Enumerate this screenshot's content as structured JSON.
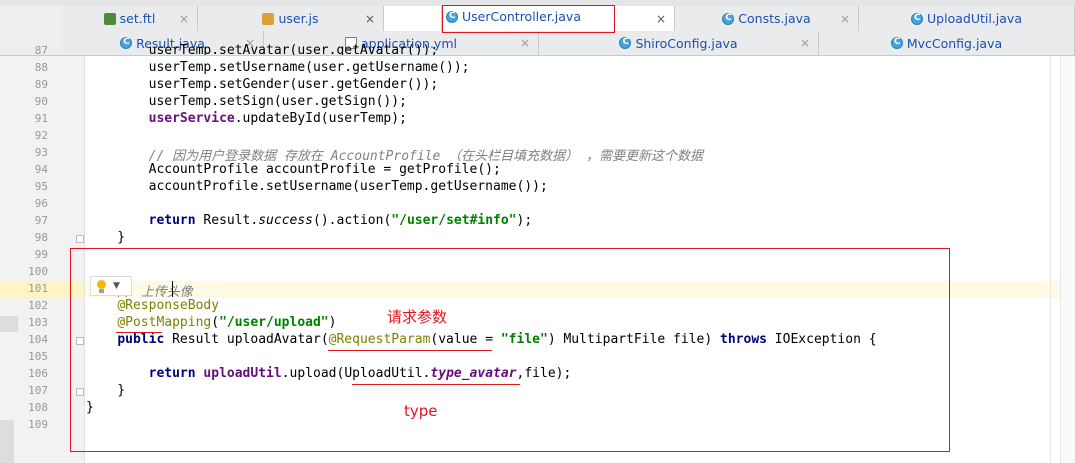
{
  "tabs_row1": [
    {
      "label": "set.ftl",
      "icon": "ftl-file-icon",
      "close": "×"
    },
    {
      "label": "user.js",
      "icon": "js-file-icon",
      "close": "×"
    },
    {
      "label": "",
      "icon": "",
      "close": ""
    },
    {
      "label": "UserController.java",
      "icon": "java-class-icon",
      "close": "×"
    },
    {
      "label": "Consts.java",
      "icon": "java-class-icon",
      "close": "×"
    },
    {
      "label": "UploadUtil.java",
      "icon": "java-class-icon",
      "close": ""
    }
  ],
  "tabs_row2": [
    {
      "label": "Result.java",
      "icon": "java-class-icon",
      "close": "×"
    },
    {
      "label": "application.yml",
      "icon": "yml-file-icon",
      "close": "×"
    },
    {
      "label": "ShiroConfig.java",
      "icon": "java-class-icon",
      "close": "×"
    },
    {
      "label": "MvcConfig.java",
      "icon": "java-class-icon",
      "close": ""
    }
  ],
  "line_numbers": [
    "87",
    "88",
    "89",
    "90",
    "91",
    "92",
    "93",
    "94",
    "95",
    "96",
    "97",
    "98",
    "99",
    "100",
    "101",
    "102",
    "103",
    "104",
    "105",
    "106",
    "107",
    "108",
    "109"
  ],
  "code": {
    "l87": "        userTemp.setAvatar(user.getAvatar());",
    "l88": "        userTemp.setUsername(user.getUsername());",
    "l89": "        userTemp.setGender(user.getGender());",
    "l90": "        userTemp.setSign(user.getSign());",
    "l91_field": "userService",
    "l91_rest": ".updateById(userTemp);",
    "l93_a": "// 因为用户登录数据 存放在 ",
    "l93_b": "AccountProfile",
    "l93_c": " （在头栏目填充数据） ，需要更新这个数据",
    "l94": "        AccountProfile accountProfile = getProfile();",
    "l95": "        accountProfile.setUsername(userTemp.getUsername());",
    "l97_kw": "return",
    "l97_a": " Result.",
    "l97_it": "success",
    "l97_b": "().action(",
    "l97_str": "\"/user/set#info\"",
    "l97_c": ");",
    "l98": "    }",
    "l101": "// 上传头像",
    "l102": "@ResponseBody",
    "l103_ann": "@PostMapping",
    "l103_p": "(",
    "l103_str": "\"/user/upload\"",
    "l103_e": ")",
    "l104_kw": "public",
    "l104_a": " Result uploadAvatar(",
    "l104_ann": "@RequestParam",
    "l104_b": "(value = ",
    "l104_str": "\"file\"",
    "l104_c": ") MultipartFile file) ",
    "l104_kw2": "throws",
    "l104_d": " IOException {",
    "l106_kw": "return",
    "l106_field": "uploadUtil",
    "l106_a": ".upload(UploadUtil.",
    "l106_static": "type_avatar",
    "l106_b": ",file);",
    "l107": "    }",
    "l108": "}"
  },
  "annotations": {
    "request_param": "请求参数",
    "type": "type"
  },
  "colors": {
    "highlight": "#e0161e",
    "keyword": "#000080",
    "string": "#008000",
    "annotation": "#808000",
    "field": "#660e7a",
    "comment": "#808080"
  }
}
